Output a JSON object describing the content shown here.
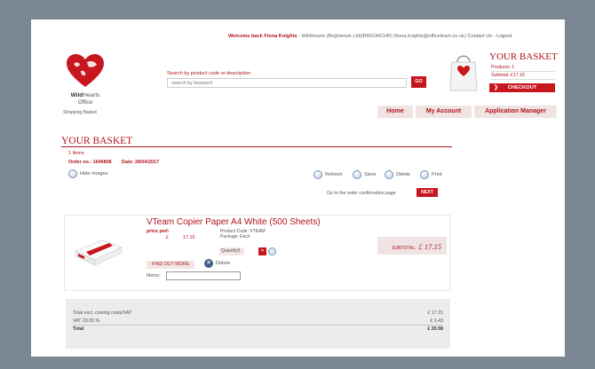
{
  "topbar": {
    "welcome": "Welcome back Fiona Knights",
    "account_info": "- Wildhearts (Brightwork Ltd)(BRIGWCHR) (fiona.knights@officeteam.co.uk)",
    "contact": "Contact Us",
    "sep": "-",
    "logout": "Logout"
  },
  "logo": {
    "name_bold": "Wild",
    "name_rest": "Hearts",
    "sub": "Office",
    "page_label": "Shopping Basket"
  },
  "search": {
    "label": "Search by product code or description",
    "placeholder": "search by keyword",
    "go": "GO"
  },
  "basket": {
    "title": "YOUR BASKET",
    "products": "Products: 1",
    "subtotal": "Subtotal: £17.15",
    "checkout": "CHECKOUT",
    "chev": "❯"
  },
  "nav": {
    "home": "Home",
    "account": "My Account",
    "app_manager": "Application Manager"
  },
  "main": {
    "title": "YOUR BASKET",
    "items": "1 Items",
    "order_no": "Order no.: 1646808",
    "date": "Date: 28/04/2017",
    "hide_images": "Hide Images",
    "actions": {
      "refresh": "Refresh",
      "store": "Store",
      "delete": "Delete",
      "print": "Print"
    },
    "goto_text": "Go to the order confirmation page",
    "next": "NEXT"
  },
  "product": {
    "title": "VTeam Copier Paper A4 White (500 Sheets)",
    "price_label": "price per",
    "price_unit": "5",
    "currency": "£",
    "price": "17.15",
    "code": "Product Code: VTEAM",
    "package": "Package: Each",
    "quantity": "Quantity5",
    "find_out_more": "FIND OUT MORE",
    "delete": "Delete",
    "memo_label": "Memo:",
    "subtotal_label": "SUBTOTAL:",
    "subtotal_value": "£ 17.15",
    "qty_del_glyph": "✕"
  },
  "totals": {
    "rows": [
      {
        "label": "Total excl. closing costs/VAT",
        "value": "£ 17.15"
      },
      {
        "label": "VAT 20.00 %",
        "value": "£ 3.43"
      },
      {
        "label": "Total",
        "value": "£ 20.58"
      }
    ]
  },
  "colors": {
    "brand": "#c8161e",
    "text_red": "#b0141d",
    "frame": "#7b8792"
  },
  "icons": {
    "logo": "heart-globe-icon",
    "bag": "shopping-bag-icon",
    "hide_images": "photo-toggle-icon",
    "refresh": "refresh-icon",
    "store": "store-icon",
    "delete": "delete-icon",
    "print": "print-icon",
    "item_delete": "close-icon"
  }
}
